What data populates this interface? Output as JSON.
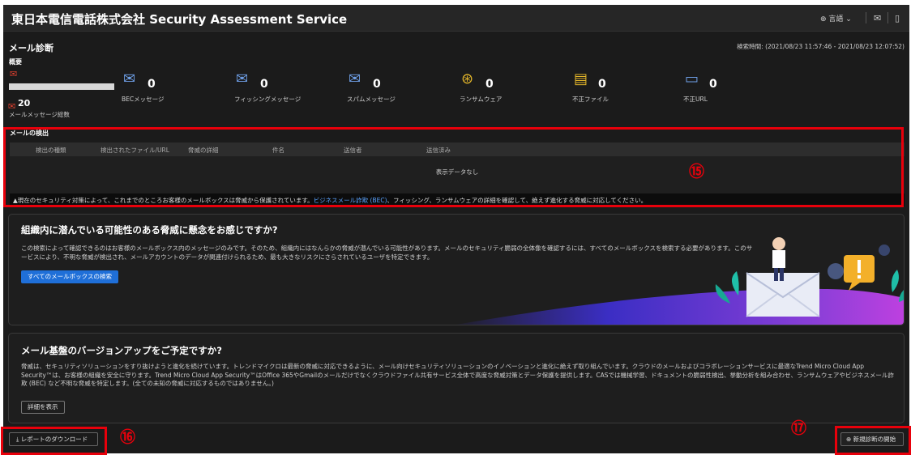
{
  "header": {
    "brand": "東日本電信電話株式会社 Security Assessment Service",
    "language": "⊕ 言語 ⌄",
    "mail_icon": "✉",
    "doc_icon": "▯"
  },
  "page": {
    "title": "メール診断",
    "scan_time": "検索時間: (2021/08/23 11:57:46 - 2021/08/23 12:07:52)",
    "overview_label": "概要"
  },
  "overview": {
    "total_count": "20",
    "total_label": "メールメッセージ総数",
    "stats": [
      {
        "icon": "bec-mail-icon",
        "value": "0",
        "label": "BECメッセージ"
      },
      {
        "icon": "phishing-mail-icon",
        "value": "0",
        "label": "フィッシングメッセージ"
      },
      {
        "icon": "spam-mail-icon",
        "value": "0",
        "label": "スパムメッセージ"
      },
      {
        "icon": "ransomware-icon",
        "value": "0",
        "label": "ランサムウェア"
      },
      {
        "icon": "malicious-file-icon",
        "value": "0",
        "label": "不正ファイル"
      },
      {
        "icon": "malicious-url-icon",
        "value": "0",
        "label": "不正URL"
      }
    ]
  },
  "detections": {
    "title": "メールの検出",
    "columns": [
      "検出の種類",
      "検出されたファイル/URL",
      "脅威の詳細",
      "件名",
      "送信者",
      "送信済み"
    ],
    "empty_text": "表示データなし",
    "notice_prefix": "▲現在のセキュリティ対策によって、これまでのところお客様のメールボックスは脅威から保護されています。",
    "notice_link": "ビジネスメール詐欺 (BEC)",
    "notice_suffix": "、フィッシング、ランサムウェアの詳細を確認して、絶えず進化する脅威に対応してください。"
  },
  "promo": {
    "heading": "組織内に潜んでいる可能性のある脅威に懸念をお感じですか?",
    "body": "この検索によって確認できるのはお客様のメールボックス内のメッセージのみです。そのため、組織内にはなんらかの脅威が潜んでいる可能性があります。メールのセキュリティ脆弱の全体像を確認するには、すべてのメールボックスを検索する必要があります。このサービスにより、不明な脅威が検出され、メールアカウントのデータが関連付けられるため、最も大きなリスクにさらされているユーザを特定できます。",
    "button": "すべてのメールボックスの検索"
  },
  "upgrade": {
    "heading": "メール基盤のバージョンアップをご予定ですか?",
    "body": "脅威は、セキュリティソリューションをすり抜けようと進化を続けています。トレンドマイクロは最新の脅威に対応できるように、メール向けセキュリティソリューションのイノベーションと進化に絶えず取り組んでいます。クラウドのメールおよびコラボレーションサービスに最適なTrend Micro Cloud App Security™は、お客様の組織を安全に守ります。Trend Micro Cloud App Security™はOffice 365やGmailのメールだけでなくクラウドファイル共有サービス全体で高度な脅威対策とデータ保護を提供します。CASでは機械学習、ドキュメントの脆弱性検出、挙動分析を組み合わせ、ランサムウェアやビジネスメール詐欺 (BEC) など不明な脅威を特定します。(全ての未知の脅威に対応するものではありません。)",
    "button": "詳細を表示"
  },
  "footer": {
    "download_button": "⤓ レポートのダウンロード",
    "new_scan_button": "⊕ 新規診断の開始"
  },
  "annotations": {
    "mark_15": "⑮",
    "mark_16": "⑯",
    "mark_17": "⑰",
    "highlight_color": "#e8000b"
  }
}
